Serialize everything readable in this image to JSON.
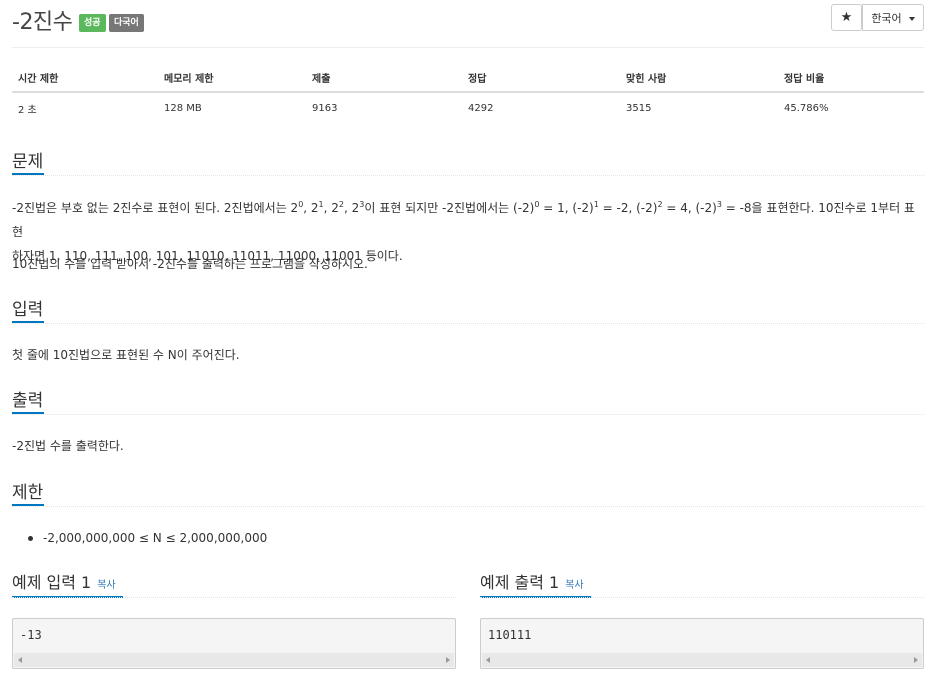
{
  "problem": {
    "title": "-2진수",
    "badges": [
      "성공",
      "다국어"
    ],
    "star_icon": "★",
    "language_select": "한국어"
  },
  "info_table": {
    "headers": [
      "시간 제한",
      "메모리 제한",
      "제출",
      "정답",
      "맞힌 사람",
      "정답 비율"
    ],
    "values": [
      "2 초",
      "128 MB",
      "9163",
      "4292",
      "3515",
      "45.786%"
    ]
  },
  "sections": {
    "problem_title": "문제",
    "input_title": "입력",
    "output_title": "출력",
    "limit_title": "제한"
  },
  "description": {
    "line1_a": "-2진법은 부호 없는 2진수로 표현이 된다. 2진법에서는 2",
    "sup0": "0",
    "comma1": ", 2",
    "sup1": "1",
    "comma2": ", 2",
    "sup2": "2",
    "comma3": ", 2",
    "sup3": "3",
    "line1_b": "이 표현 되지만 -2진법에서는 (-2)",
    "s0": "0",
    "e0": " = 1, (-2)",
    "s1": "1",
    "e1": " = -2, (-2)",
    "s2": "2",
    "e2": " = 4, (-2)",
    "s3": "3",
    "e3": " = -8을 표현한다. 10진수로 1부터 표현",
    "line2": "하자면 1, 110, 111, 100, 101, 11010, 11011, 11000, 11001 등이다.",
    "line3": "10진법의 수를 입력 받아서 -2진수를 출력하는 프로그램을 작성하시오."
  },
  "input_text": "첫 줄에 10진법으로 표현된 수 N이 주어진다.",
  "output_text": "-2진법 수를 출력한다.",
  "limit_text": "-2,000,000,000 ≤ N ≤ 2,000,000,000",
  "samples": {
    "input_title": "예제 입력 1",
    "output_title": "예제 출력 1",
    "copy_label": "복사",
    "input_value": "-13",
    "output_value": "110111"
  },
  "colors": {
    "success_badge": "#5cb85c",
    "multilang_badge": "#777777",
    "section_accent": "#0076c0",
    "copy_link": "#337ab7"
  }
}
